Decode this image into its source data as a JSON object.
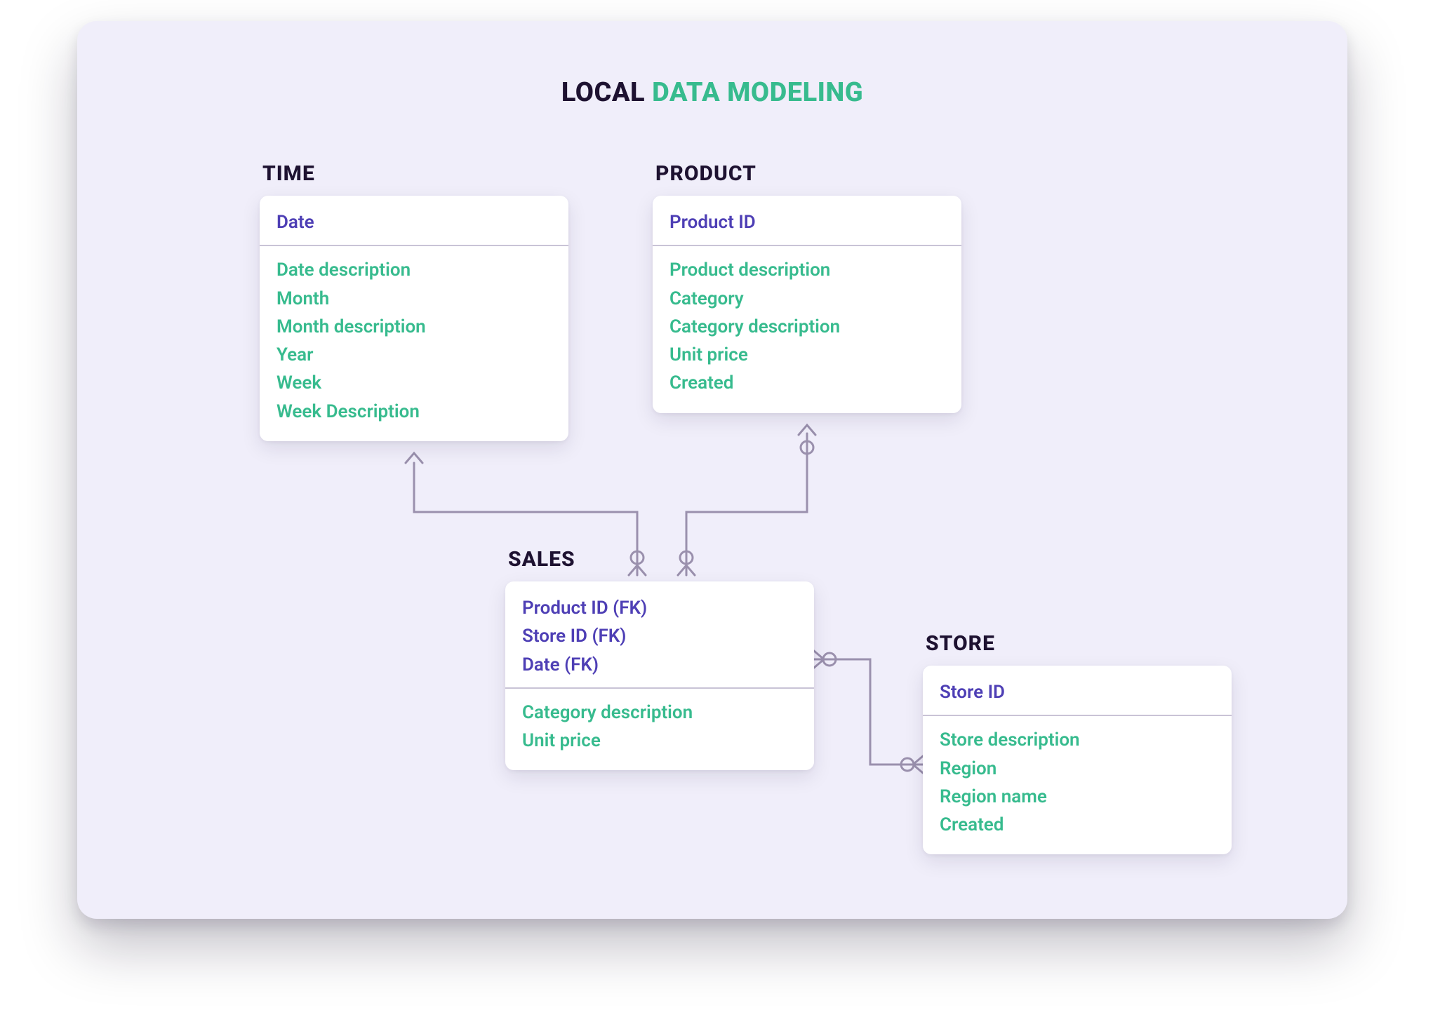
{
  "title": {
    "part1": "LOCAL ",
    "part2": "DATA MODELING"
  },
  "colors": {
    "panel_bg": "#F0EEFA",
    "heading": "#1E1231",
    "accent_green": "#37BB8E",
    "key_purple": "#4E3FB5",
    "line_gray": "#9A90AD"
  },
  "entities": {
    "time": {
      "title": "TIME",
      "keys": [
        "Date"
      ],
      "attrs": [
        "Date description",
        "Month",
        "Month description",
        "Year",
        "Week",
        "Week Description"
      ]
    },
    "product": {
      "title": "PRODUCT",
      "keys": [
        "Product ID"
      ],
      "attrs": [
        "Product description",
        "Category",
        "Category description",
        "Unit price",
        "Created"
      ]
    },
    "sales": {
      "title": "SALES",
      "keys": [
        "Product ID (FK)",
        "Store ID (FK)",
        "Date (FK)"
      ],
      "attrs": [
        "Category description",
        "Unit price"
      ]
    },
    "store": {
      "title": "STORE",
      "keys": [
        "Store ID"
      ],
      "attrs": [
        "Store description",
        "Region",
        "Region name",
        "Created"
      ]
    }
  },
  "relationships": [
    {
      "from": "time",
      "to": "sales",
      "from_card": "one",
      "to_card": "many"
    },
    {
      "from": "product",
      "to": "sales",
      "from_card": "one",
      "to_card": "many"
    },
    {
      "from": "sales",
      "to": "store",
      "from_card": "many",
      "to_card": "one"
    }
  ]
}
